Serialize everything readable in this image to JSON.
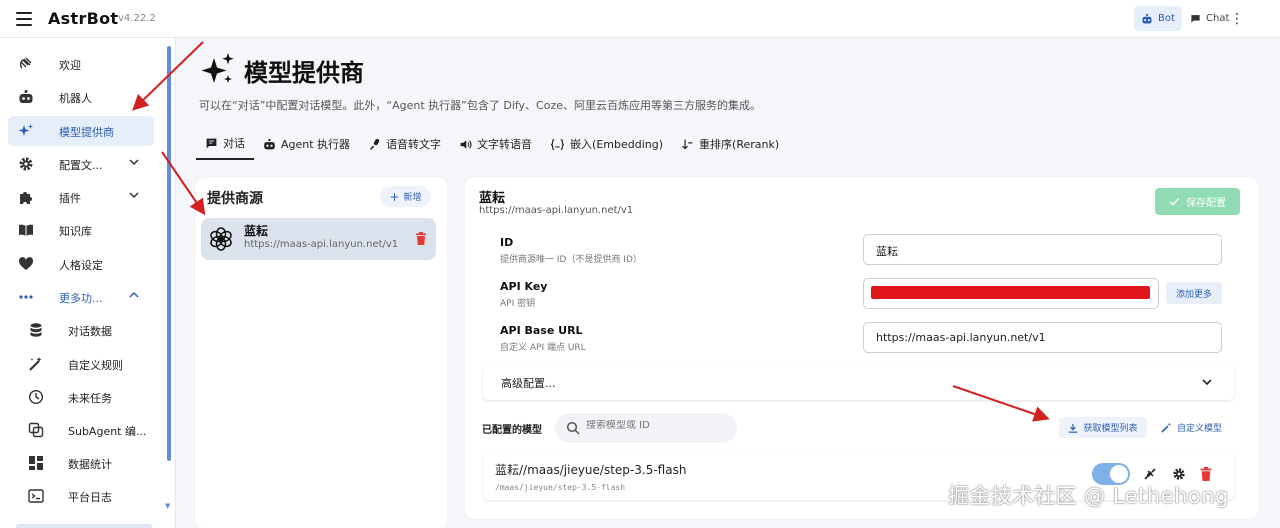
{
  "app": {
    "brand": "AstrBot",
    "version": "v4.22.2"
  },
  "topbar": {
    "bot_label": "Bot",
    "chat_label": "Chat"
  },
  "sidebar": {
    "items": [
      {
        "label": "欢迎"
      },
      {
        "label": "机器人"
      },
      {
        "label": "模型提供商"
      },
      {
        "label": "配置文..."
      },
      {
        "label": "插件"
      },
      {
        "label": "知识库"
      },
      {
        "label": "人格设定"
      },
      {
        "label": "更多功..."
      }
    ],
    "sub_items": [
      {
        "label": "对话数据"
      },
      {
        "label": "自定义规则"
      },
      {
        "label": "未来任务"
      },
      {
        "label": "SubAgent 编..."
      },
      {
        "label": "数据统计"
      },
      {
        "label": "平台日志"
      }
    ]
  },
  "page": {
    "title": "模型提供商",
    "description": "可以在“对话”中配置对话模型。此外，“Agent 执行器”包含了 Dify、Coze、阿里云百炼应用等第三方服务的集成。"
  },
  "tabs": [
    {
      "label": "对话"
    },
    {
      "label": "Agent 执行器"
    },
    {
      "label": "语音转文字"
    },
    {
      "label": "文字转语音"
    },
    {
      "label": "嵌入(Embedding)"
    },
    {
      "label": "重排序(Rerank)"
    }
  ],
  "providers": {
    "title": "提供商源",
    "add_label": "新增",
    "items": [
      {
        "name": "蓝耘",
        "url": "https://maas-api.lanyun.net/v1"
      }
    ]
  },
  "detail": {
    "name": "蓝耘",
    "url": "https://maas-api.lanyun.net/v1",
    "save_label": "保存配置",
    "fields": {
      "id": {
        "label": "ID",
        "hint": "提供商源唯一 ID（不是提供商 ID）",
        "value": "蓝耘"
      },
      "api_key": {
        "label": "API Key",
        "hint": "API 密钥",
        "more_label": "添加更多"
      },
      "base_url": {
        "label": "API Base URL",
        "hint": "自定义 API 端点 URL",
        "value": "https://maas-api.lanyun.net/v1"
      }
    },
    "advanced_label": "高级配置...",
    "models_label": "已配置的模型",
    "search_placeholder": "搜索模型或 ID",
    "fetch_label": "获取模型列表",
    "custom_label": "自定义模型",
    "models": [
      {
        "name": "蓝耘//maas/jieyue/step-3.5-flash",
        "id": "/maas/jieyue/step-3.5-flash",
        "enabled": true
      }
    ]
  },
  "watermark": "掘金技术社区 @ Lethehong",
  "colors": {
    "accent": "#2b5fb4",
    "active_bg": "#e6eef9",
    "save": "#8fdcb4",
    "danger": "#e53935",
    "annotation": "#d32020"
  }
}
